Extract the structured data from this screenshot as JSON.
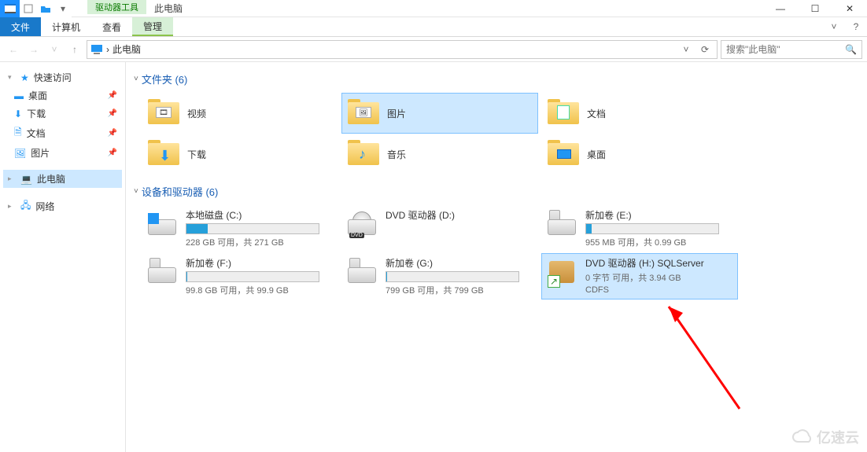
{
  "titlebar": {
    "contextual_tab": "驱动器工具",
    "title": "此电脑",
    "minimize_g": "—",
    "maximize_g": "☐",
    "close_g": "✕"
  },
  "ribbon": {
    "file": "文件",
    "tabs": [
      "计算机",
      "查看"
    ],
    "contextual": "管理",
    "help_g": "?",
    "collapse_g": "˅"
  },
  "nav": {
    "back_g": "←",
    "forward_g": "→",
    "up_g": "↑",
    "down_g": "˅"
  },
  "address": {
    "sep": "›",
    "current": "此电脑",
    "drop_g": "˅",
    "refresh_g": "⟳"
  },
  "search": {
    "placeholder": "搜索\"此电脑\"",
    "glyph": "🔍"
  },
  "sidebar": {
    "quick": "快速访问",
    "items": [
      {
        "label": "桌面",
        "icon": "desktop"
      },
      {
        "label": "下载",
        "icon": "download"
      },
      {
        "label": "文档",
        "icon": "doc"
      },
      {
        "label": "图片",
        "icon": "picture"
      }
    ],
    "thispc": "此电脑",
    "network": "网络"
  },
  "groups": {
    "folders_title": "文件夹 (6)",
    "drives_title": "设备和驱动器 (6)"
  },
  "folders": [
    {
      "name": "视频",
      "icon": "video"
    },
    {
      "name": "图片",
      "icon": "picture",
      "selected": true
    },
    {
      "name": "文档",
      "icon": "doc"
    },
    {
      "name": "下载",
      "icon": "download"
    },
    {
      "name": "音乐",
      "icon": "music"
    },
    {
      "name": "桌面",
      "icon": "desktop"
    }
  ],
  "drives": [
    {
      "title": "本地磁盘 (C:)",
      "bar": 0.16,
      "sub": "228 GB 可用，共 271 GB",
      "icon": "hdd-os"
    },
    {
      "title": "DVD 驱动器 (D:)",
      "sub": "",
      "icon": "dvd",
      "nobar": true
    },
    {
      "title": "新加卷 (E:)",
      "bar": 0.04,
      "sub": "955 MB 可用，共 0.99 GB",
      "icon": "hdd"
    },
    {
      "title": "新加卷 (F:)",
      "bar": 0.001,
      "sub": "99.8 GB 可用，共 99.9 GB",
      "icon": "hdd"
    },
    {
      "title": "新加卷 (G:)",
      "bar": 0.001,
      "sub": "799 GB 可用，共 799 GB",
      "icon": "hdd"
    },
    {
      "title": "DVD 驱动器 (H:) SQLServer",
      "sub": "0 字节 可用，共 3.94 GB",
      "sub2": "CDFS",
      "icon": "box",
      "nobar": true,
      "selected": true
    }
  ],
  "watermark": "亿速云"
}
